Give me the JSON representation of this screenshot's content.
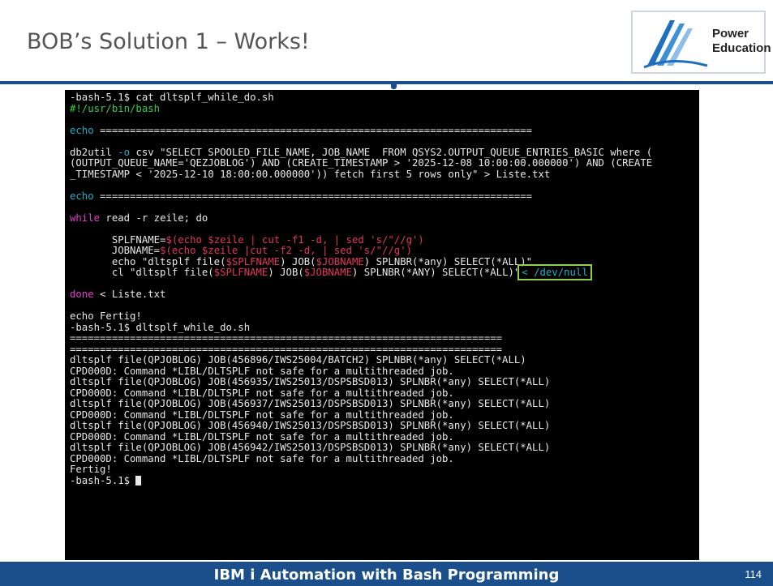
{
  "slide": {
    "title": "BOB’s Solution 1 – Works!",
    "footer": "IBM i Automation with Bash Programming",
    "page_number": "114"
  },
  "logo": {
    "line1": "Power",
    "line2": "Education"
  },
  "colors": {
    "footer_bar": "#1a4f8c",
    "terminal_bg": "#000000",
    "text": "#e8e8e8",
    "green": "#35d04a",
    "cyan": "#1fb0c8",
    "red": "#e4355c",
    "magenta": "#e33fd0",
    "highlight_box": "#8fd14f"
  },
  "terminal": {
    "lines": [
      [
        {
          "t": "-bash-5.1$ cat dltsplf_while_do.sh",
          "c": "white"
        }
      ],
      [
        {
          "t": "#!/usr/bin/bash",
          "c": "green"
        }
      ],
      [
        {
          "t": "",
          "c": "white"
        }
      ],
      [
        {
          "t": "echo ",
          "c": "cyan"
        },
        {
          "t": "========================================================================",
          "c": "white"
        }
      ],
      [
        {
          "t": "",
          "c": "white"
        }
      ],
      [
        {
          "t": "db2util ",
          "c": "white"
        },
        {
          "t": "-o",
          "c": "cyan"
        },
        {
          "t": " csv \"SELECT SPOOLED_FILE_NAME, JOB_NAME  FROM QSYS2.OUTPUT_QUEUE_ENTRIES_BASIC where (",
          "c": "white"
        }
      ],
      [
        {
          "t": "(OUTPUT_QUEUE_NAME='QEZJOBLOG') AND (CREATE_TIMESTAMP > '2025-12-08 10:00:00.000000') AND (CREATE",
          "c": "white"
        }
      ],
      [
        {
          "t": "_TIMESTAMP < '2025-12-10 18:00:00.000000')) fetch first 5 rows only\" > Liste.txt",
          "c": "white"
        }
      ],
      [
        {
          "t": "",
          "c": "white"
        }
      ],
      [
        {
          "t": "echo ",
          "c": "cyan"
        },
        {
          "t": "========================================================================",
          "c": "white"
        }
      ],
      [
        {
          "t": "",
          "c": "white"
        }
      ],
      [
        {
          "t": "while",
          "c": "magenta"
        },
        {
          "t": " read -r zeile; do",
          "c": "white"
        }
      ],
      [
        {
          "t": "",
          "c": "white"
        }
      ],
      [
        {
          "t": "       SPLFNAME=",
          "c": "white"
        },
        {
          "t": "$(echo $zeile | cut -f1 -d, | sed 's/\"//g')",
          "c": "red"
        }
      ],
      [
        {
          "t": "       JOBNAME=",
          "c": "white"
        },
        {
          "t": "$(echo $zeile |cut -f2 -d, | sed 's/\"//g')",
          "c": "red"
        }
      ],
      [
        {
          "t": "       echo \"dltsplf file(",
          "c": "white"
        },
        {
          "t": "$SPLFNAME",
          "c": "red"
        },
        {
          "t": ") JOB(",
          "c": "white"
        },
        {
          "t": "$JOBNAME",
          "c": "red"
        },
        {
          "t": ") SPLNBR(*any) SELECT(*ALL)\"",
          "c": "white"
        }
      ],
      [
        {
          "t": "       cl \"dltsplf file(",
          "c": "white"
        },
        {
          "t": "$SPLFNAME",
          "c": "red"
        },
        {
          "t": ") JOB(",
          "c": "white"
        },
        {
          "t": "$JOBNAME",
          "c": "red"
        },
        {
          "t": ") SPLNBR(*ANY) SELECT(*ALL)\"",
          "c": "white"
        },
        {
          "t": "< /dev/null",
          "c": "cyan",
          "box": true
        }
      ],
      [
        {
          "t": "",
          "c": "white"
        }
      ],
      [
        {
          "t": "done",
          "c": "magenta"
        },
        {
          "t": " < Liste.txt",
          "c": "white"
        }
      ],
      [
        {
          "t": "",
          "c": "white"
        }
      ],
      [
        {
          "t": "echo Fertig!",
          "c": "white"
        }
      ],
      [
        {
          "t": "-bash-5.1$ dltsplf_while_do.sh",
          "c": "white"
        }
      ],
      [
        {
          "t": "========================================================================",
          "c": "white"
        }
      ],
      [
        {
          "t": "========================================================================",
          "c": "white"
        }
      ],
      [
        {
          "t": "dltsplf file(QPJOBLOG) JOB(456896/IWS25004/BATCH2) SPLNBR(*any) SELECT(*ALL)",
          "c": "white"
        }
      ],
      [
        {
          "t": "CPD000D: Command *LIBL/DLTSPLF not safe for a multithreaded job.",
          "c": "white"
        }
      ],
      [
        {
          "t": "dltsplf file(QPJOBLOG) JOB(456935/IWS25013/DSPSBSD013) SPLNBR(*any) SELECT(*ALL)",
          "c": "white"
        }
      ],
      [
        {
          "t": "CPD000D: Command *LIBL/DLTSPLF not safe for a multithreaded job.",
          "c": "white"
        }
      ],
      [
        {
          "t": "dltsplf file(QPJOBLOG) JOB(456937/IWS25013/DSPSBSD013) SPLNBR(*any) SELECT(*ALL)",
          "c": "white"
        }
      ],
      [
        {
          "t": "CPD000D: Command *LIBL/DLTSPLF not safe for a multithreaded job.",
          "c": "white"
        }
      ],
      [
        {
          "t": "dltsplf file(QPJOBLOG) JOB(456940/IWS25013/DSPSBSD013) SPLNBR(*any) SELECT(*ALL)",
          "c": "white"
        }
      ],
      [
        {
          "t": "CPD000D: Command *LIBL/DLTSPLF not safe for a multithreaded job.",
          "c": "white"
        }
      ],
      [
        {
          "t": "dltsplf file(QPJOBLOG) JOB(456942/IWS25013/DSPSBSD013) SPLNBR(*any) SELECT(*ALL)",
          "c": "white"
        }
      ],
      [
        {
          "t": "CPD000D: Command *LIBL/DLTSPLF not safe for a multithreaded job.",
          "c": "white"
        }
      ],
      [
        {
          "t": "Fertig!",
          "c": "white"
        }
      ],
      [
        {
          "t": "-bash-5.1$ ",
          "c": "white",
          "cursor": true
        }
      ]
    ]
  }
}
